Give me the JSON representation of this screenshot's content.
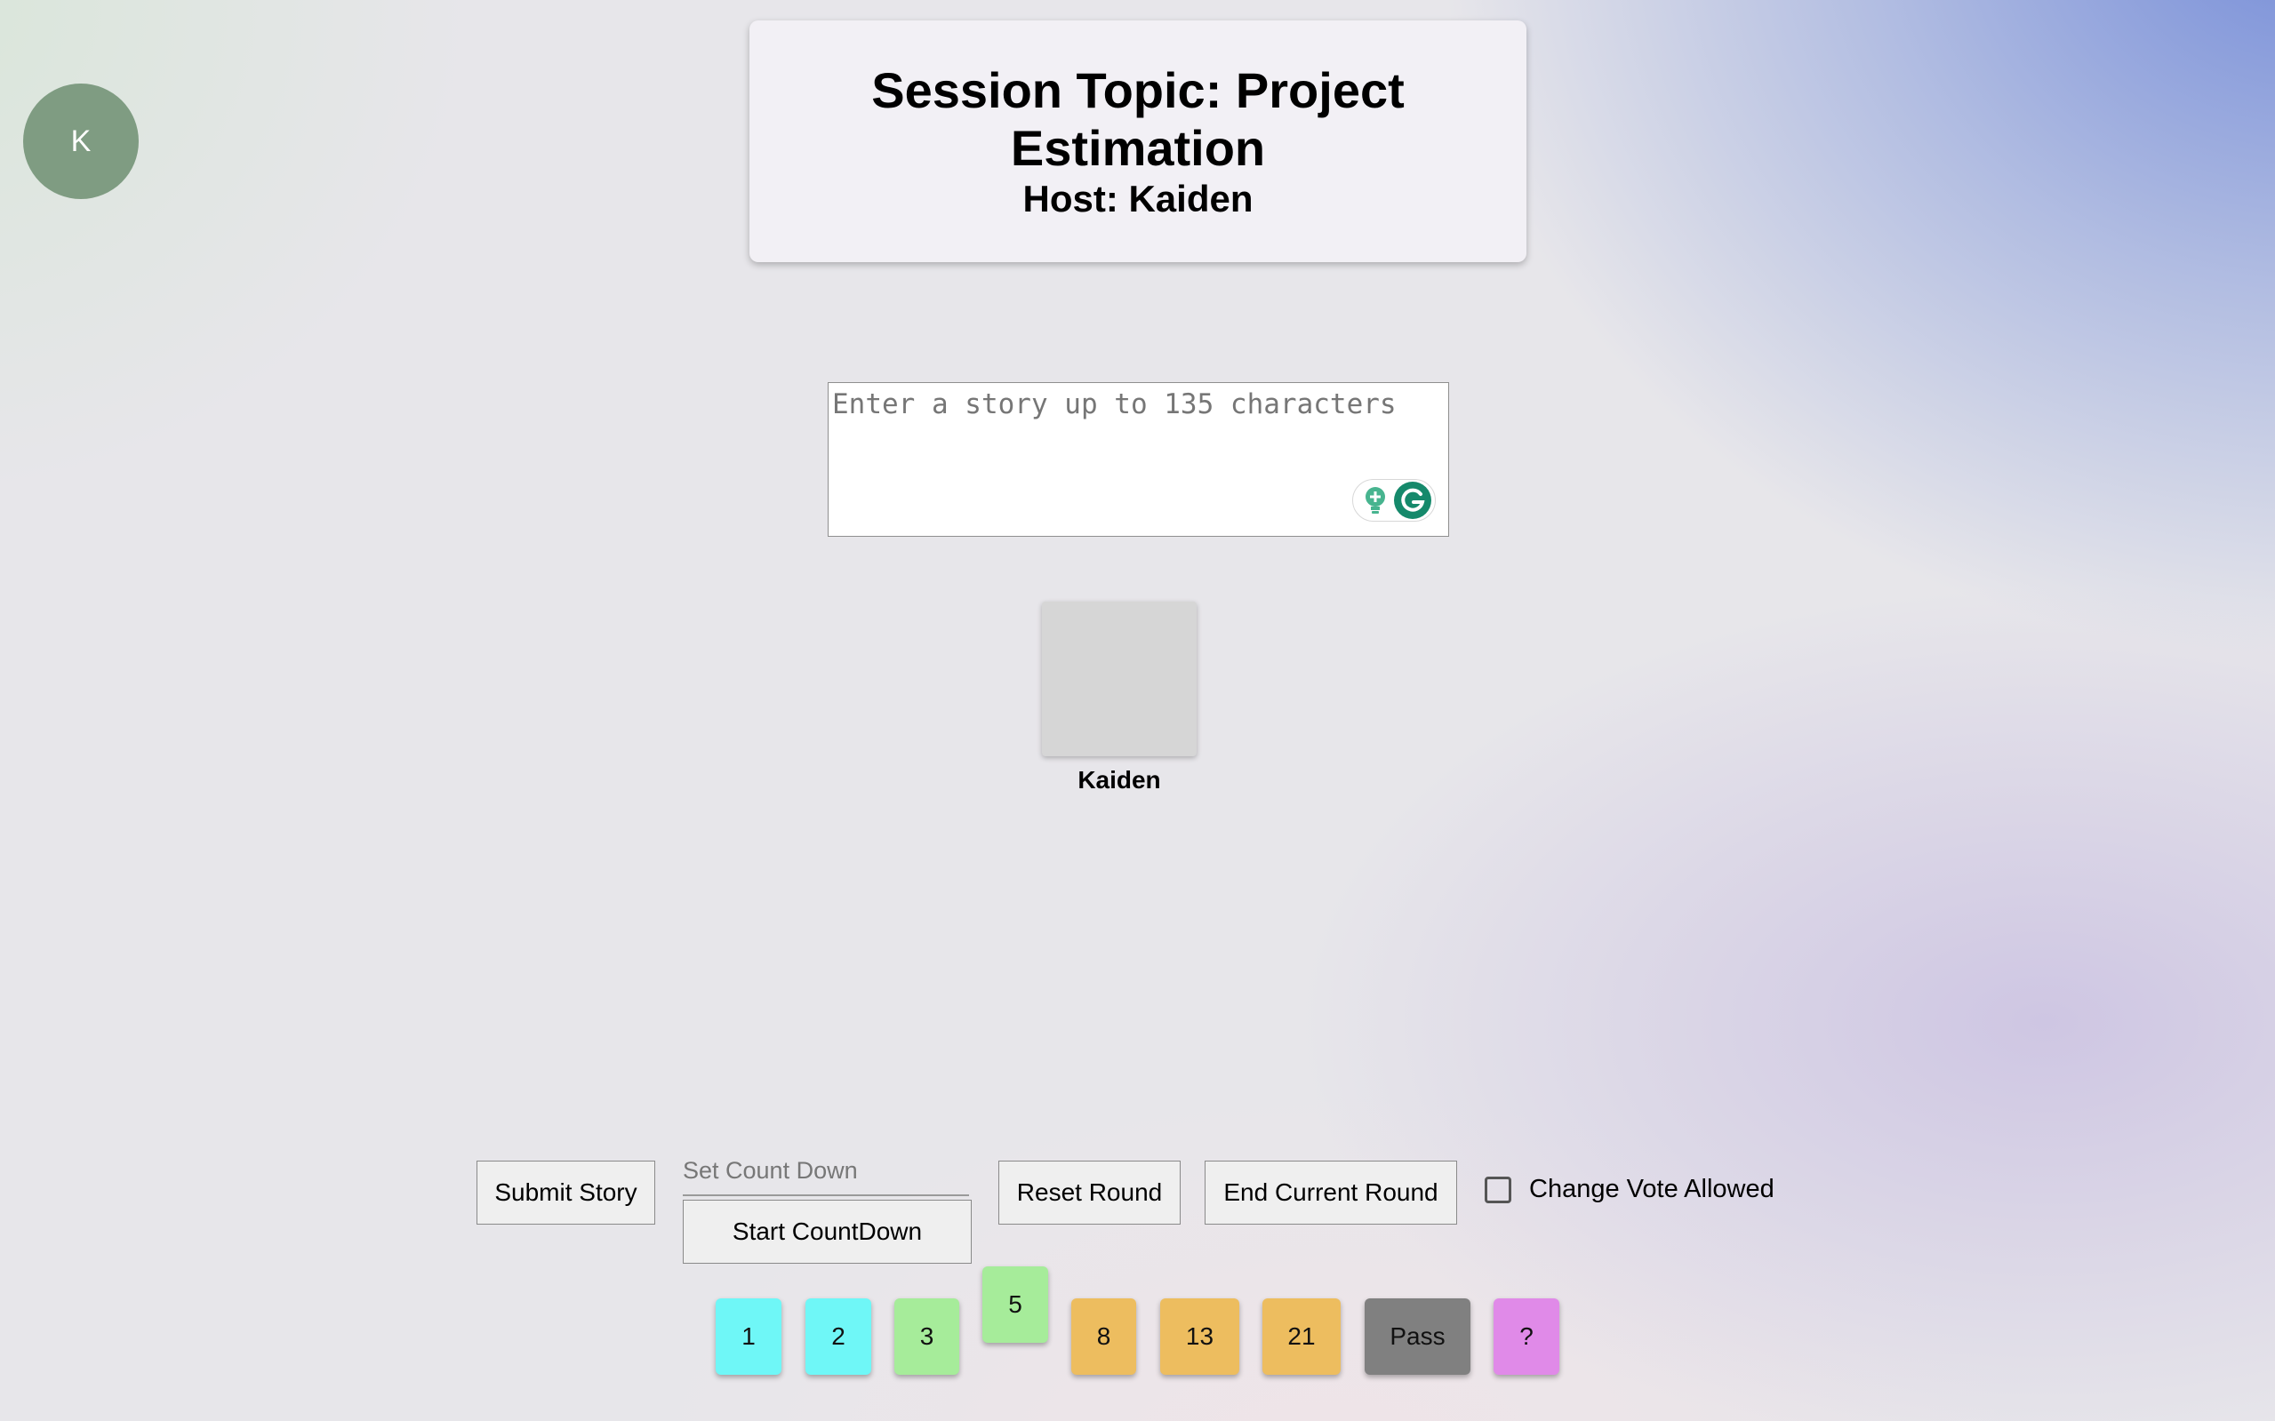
{
  "user": {
    "avatar_initial": "K"
  },
  "session": {
    "topic_line1": "Session Topic: Project",
    "topic_line2": "Estimation",
    "host": "Host: Kaiden"
  },
  "story_input": {
    "placeholder": "Enter a story up to 135 characters",
    "value": ""
  },
  "players": [
    {
      "name": "Kaiden"
    }
  ],
  "controls": {
    "submit_story": "Submit Story",
    "countdown_placeholder": "Set Count Down",
    "start_countdown": "Start CountDown",
    "reset_round": "Reset Round",
    "end_round": "End Current Round",
    "change_vote_label": "Change Vote Allowed",
    "change_vote_checked": false
  },
  "vote_cards": [
    {
      "label": "1",
      "color": "#6ff7f7"
    },
    {
      "label": "2",
      "color": "#6ff7f7"
    },
    {
      "label": "3",
      "color": "#a6ec9a"
    },
    {
      "label": "5",
      "color": "#a6ec9a",
      "selected": true
    },
    {
      "label": "8",
      "color": "#edbd5f"
    },
    {
      "label": "13",
      "color": "#edbd5f"
    },
    {
      "label": "21",
      "color": "#edbd5f"
    },
    {
      "label": "Pass",
      "color": "#808080"
    },
    {
      "label": "?",
      "color": "#e08ae8"
    }
  ],
  "icons": {
    "grammarly": [
      "grammarly-bulb-icon",
      "grammarly-logo-icon"
    ]
  }
}
